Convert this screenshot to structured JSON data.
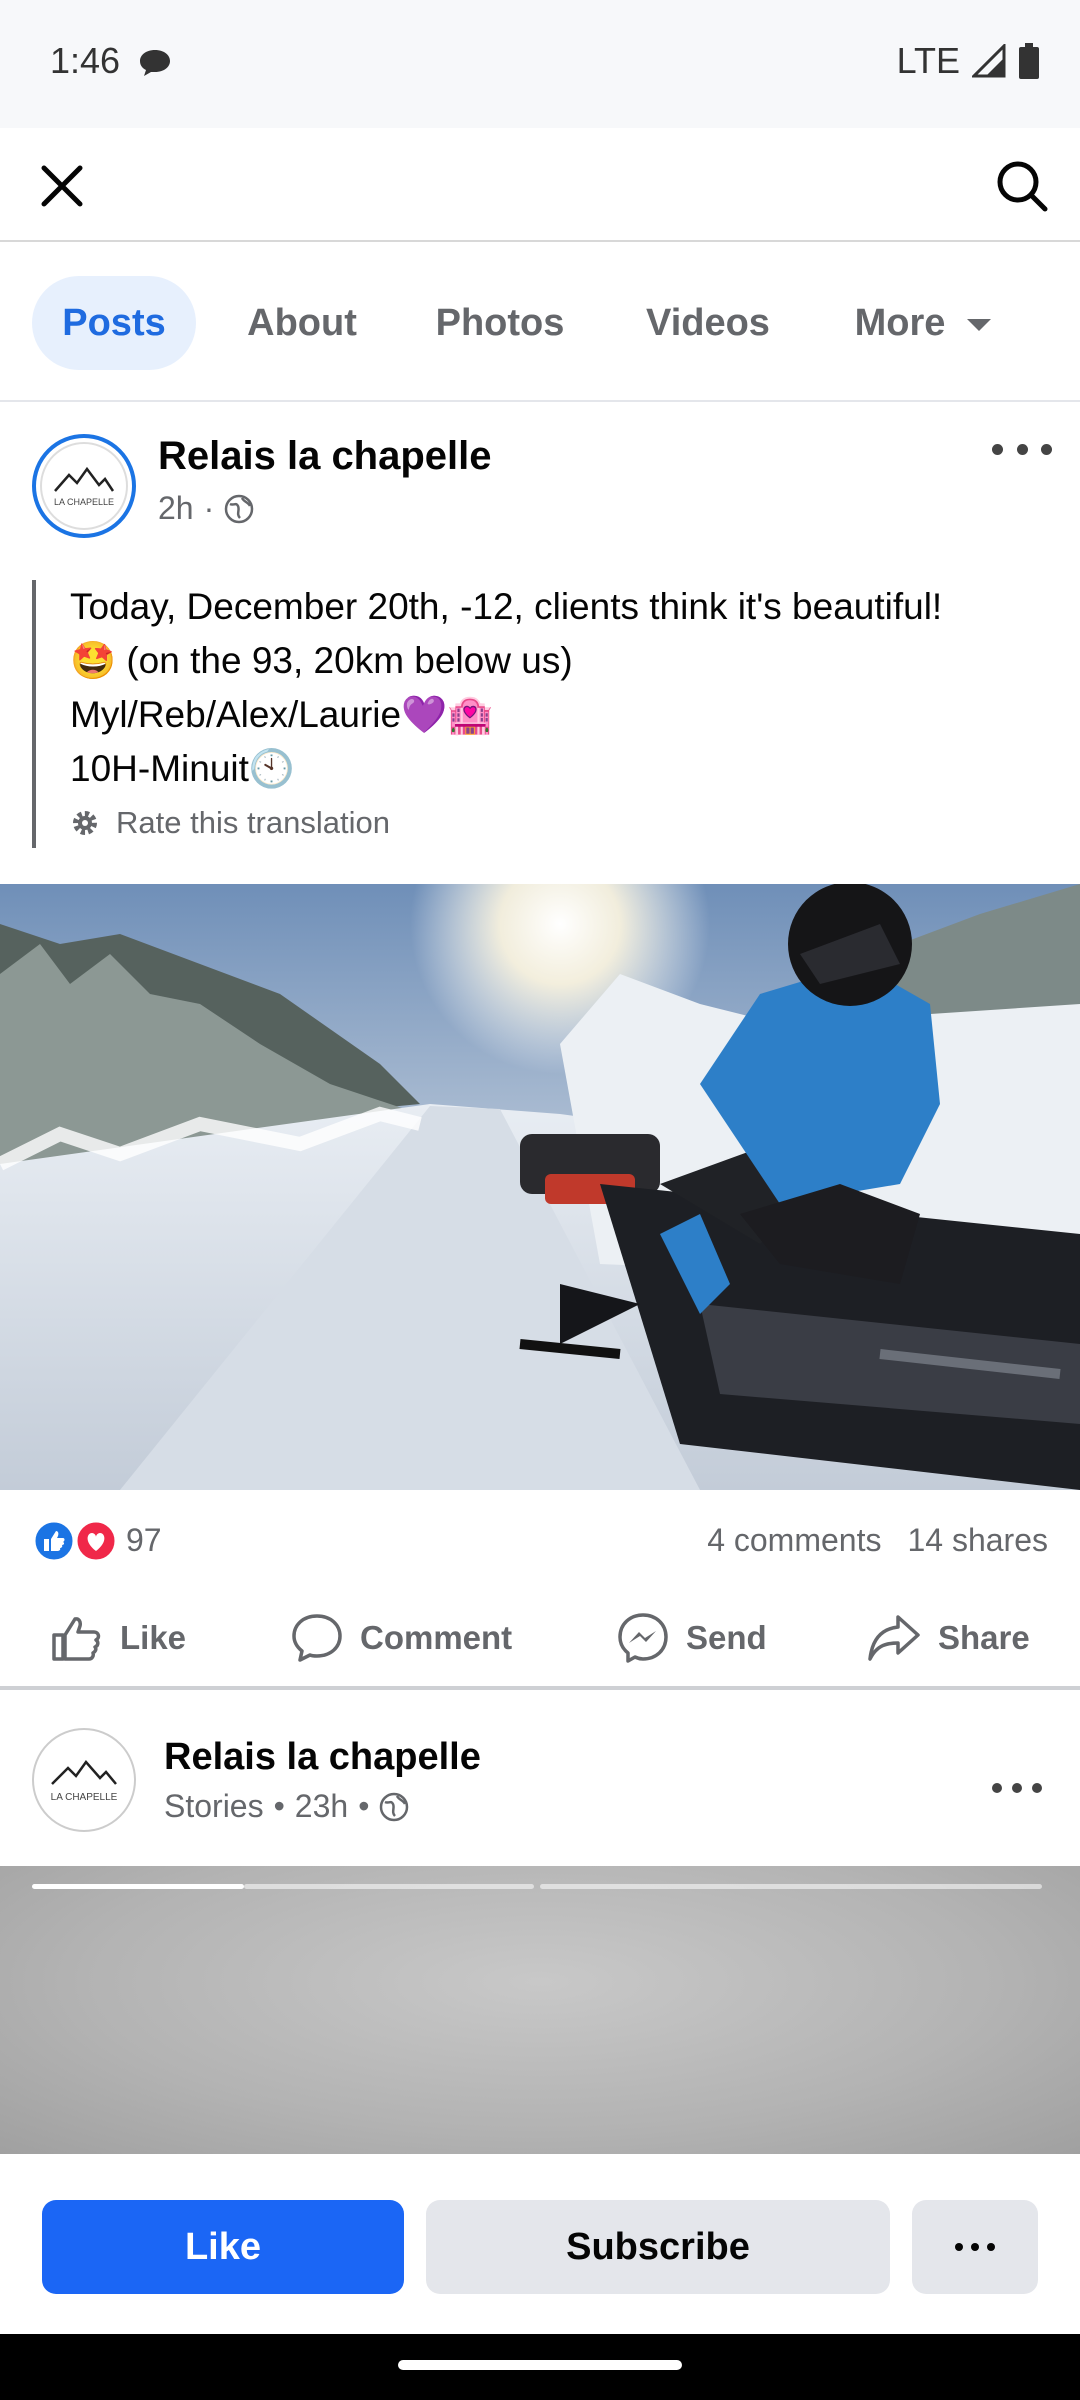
{
  "status_bar": {
    "time": "1:46",
    "network": "LTE"
  },
  "tabs": [
    {
      "label": "Posts",
      "active": true
    },
    {
      "label": "About",
      "active": false
    },
    {
      "label": "Photos",
      "active": false
    },
    {
      "label": "Videos",
      "active": false
    },
    {
      "label": "More",
      "active": false
    }
  ],
  "post": {
    "author": "Relais la chapelle",
    "time": "2h",
    "separator": "·",
    "text_lines": [
      "Today, December 20th, -12, clients think it's beautiful!",
      "🤩 (on the 93, 20km below us)",
      "Myl/Reb/Alex/Laurie💜🏩",
      "10H-Minuit🕙"
    ],
    "rate_translation": "Rate this translation",
    "reactions_count": "97",
    "comments": "4 comments",
    "shares": "14 shares",
    "actions": {
      "like": "Like",
      "comment": "Comment",
      "send": "Send",
      "share": "Share"
    }
  },
  "post2": {
    "author": "Relais la chapelle",
    "source": "Stories",
    "time": "23h",
    "separator": "•"
  },
  "avatar_logo_text": "LA CHAPELLE",
  "bottom_bar": {
    "like": "Like",
    "subscribe": "Subscribe"
  },
  "colors": {
    "accent": "#1b66f5",
    "active_tab_bg": "#e7f0fd",
    "active_tab_text": "#1f6be0",
    "secondary_text": "#65676b"
  }
}
